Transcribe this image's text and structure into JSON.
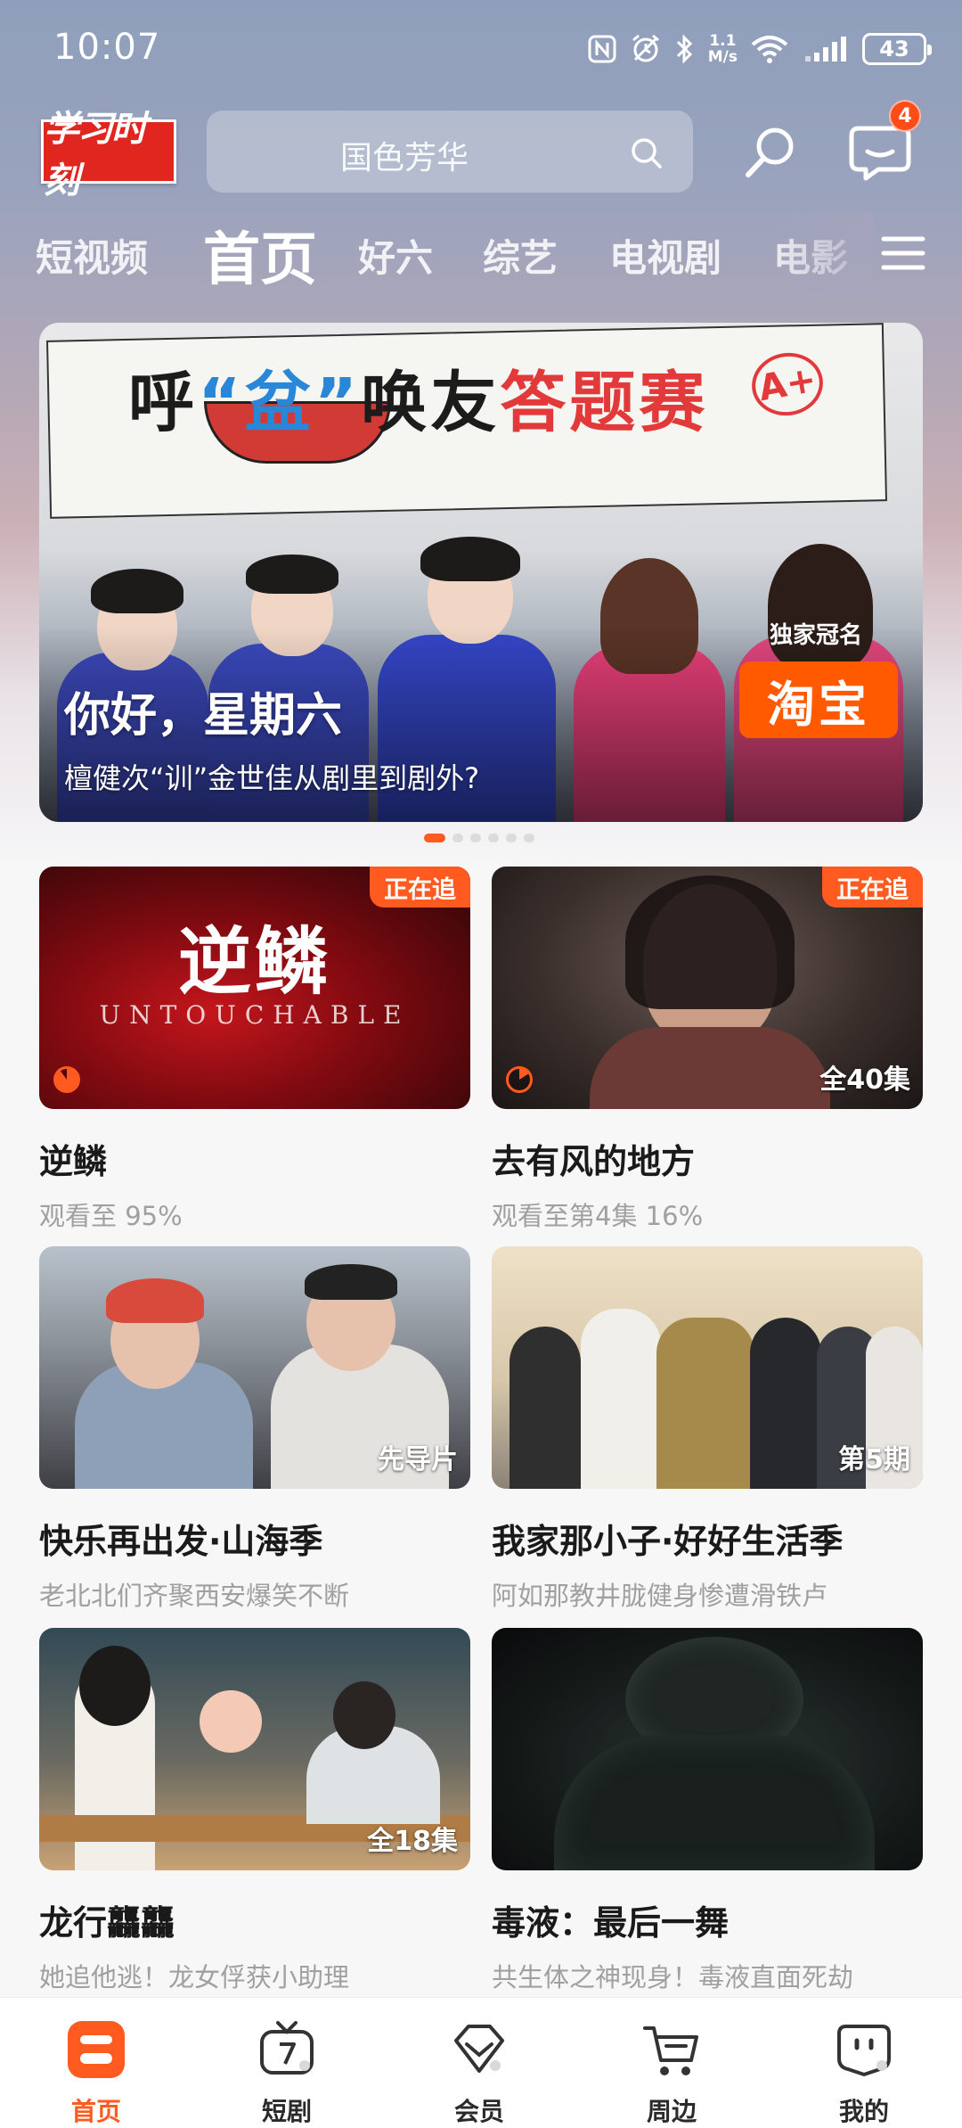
{
  "status_bar": {
    "time": "10:07",
    "net_speed_top": "1.1",
    "net_speed_bottom": "M/s",
    "battery": "43",
    "icons": [
      "nfc-icon",
      "alarm-icon",
      "bluetooth-icon",
      "wifi-icon",
      "signal-icon",
      "battery-icon"
    ]
  },
  "header": {
    "logo_text": "学习时刻",
    "search_placeholder": "国色芳华",
    "message_count": "4"
  },
  "tabs": [
    "短视频",
    "首页",
    "好六",
    "综艺",
    "电视剧",
    "电影"
  ],
  "active_tab": "首页",
  "banner": {
    "title_parts": [
      "呼",
      "“盆”",
      "唤友",
      "答题赛"
    ],
    "sponsor_label": "独家冠名",
    "sponsor": "淘宝",
    "headline": "你好，星期六",
    "subtitle": "檀健次“训”金世佳从剧里到剧外?",
    "pages": 6,
    "active_page": 0
  },
  "cards": [
    {
      "title": "逆鳞",
      "subtitle": "观看至 95%",
      "badge": "正在追",
      "episodes": "",
      "poster_title": "逆鳞",
      "poster_en": "UNTOUCHABLE"
    },
    {
      "title": "去有风的地方",
      "subtitle": "观看至第4集 16%",
      "badge": "正在追",
      "episodes": "全40集"
    },
    {
      "title": "快乐再出发·山海季",
      "subtitle": "老北北们齐聚西安爆笑不断",
      "badge": "",
      "episodes": "先导片"
    },
    {
      "title": "我家那小子·好好生活季",
      "subtitle": "阿如那教井胧健身惨遭滑铁卢",
      "badge": "",
      "episodes": "第5期"
    },
    {
      "title": "龙行龘龘",
      "subtitle": "她追他逃！龙女俘获小助理",
      "badge": "",
      "episodes": "全18集"
    },
    {
      "title": "毒液：最后一舞",
      "subtitle": "共生体之神现身！毒液直面死劫",
      "badge": "",
      "episodes": ""
    }
  ],
  "bottom_nav": [
    {
      "label": "首页",
      "icon": "home-icon",
      "active": true
    },
    {
      "label": "短剧",
      "icon": "tv-icon",
      "active": false
    },
    {
      "label": "会员",
      "icon": "vip-icon",
      "active": false
    },
    {
      "label": "周边",
      "icon": "cart-icon",
      "active": false
    },
    {
      "label": "我的",
      "icon": "profile-icon",
      "active": false
    }
  ],
  "colors": {
    "accent": "#ff5a1f",
    "logo_red": "#e0261f",
    "taobao_orange": "#ff5a00"
  }
}
